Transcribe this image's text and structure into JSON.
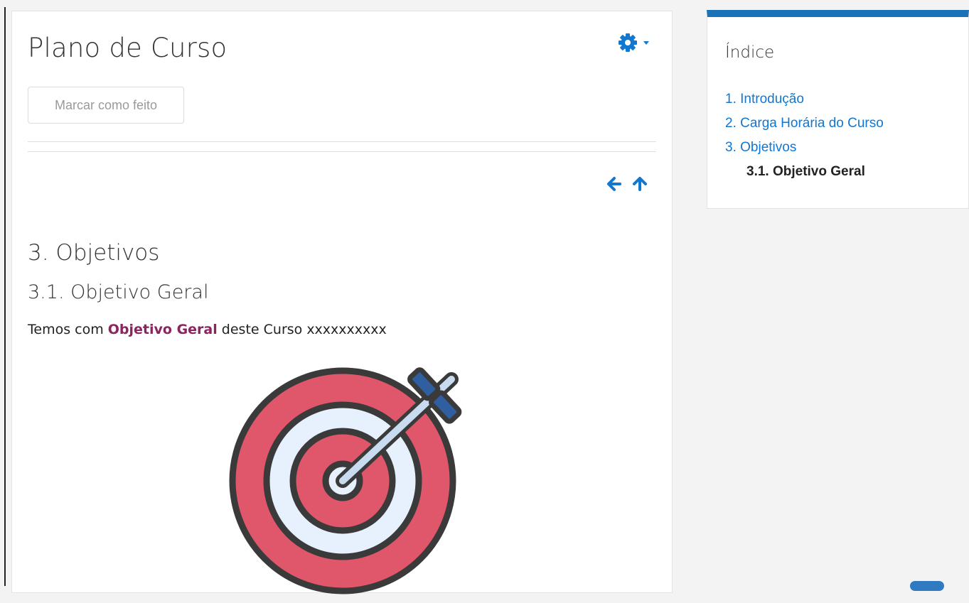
{
  "page": {
    "title": "Plano de Curso",
    "mark_done_label": "Marcar como feito",
    "settings_icon": "gear-icon",
    "nav": {
      "prev_icon": "arrow-left-icon",
      "up_icon": "arrow-up-icon"
    }
  },
  "content": {
    "section_title": "3. Objetivos",
    "subsection_title": "3.1. Objetivo Geral",
    "paragraph": {
      "before": "Temos com ",
      "highlight": "Objetivo Geral",
      "after": " deste Curso xxxxxxxxxx"
    },
    "image": "target-dart-icon"
  },
  "index": {
    "title": "Índice",
    "items": [
      {
        "label": "1. Introdução"
      },
      {
        "label": "2. Carga Horária do Curso"
      },
      {
        "label": "3. Objetivos"
      }
    ],
    "current_item": "3.1. Objetivo Geral"
  },
  "colors": {
    "link": "#1177d1",
    "accent_bar": "#1a73b8",
    "highlight_text": "#8b2460",
    "target_red": "#e0566a",
    "target_light": "#e6f1fd"
  }
}
